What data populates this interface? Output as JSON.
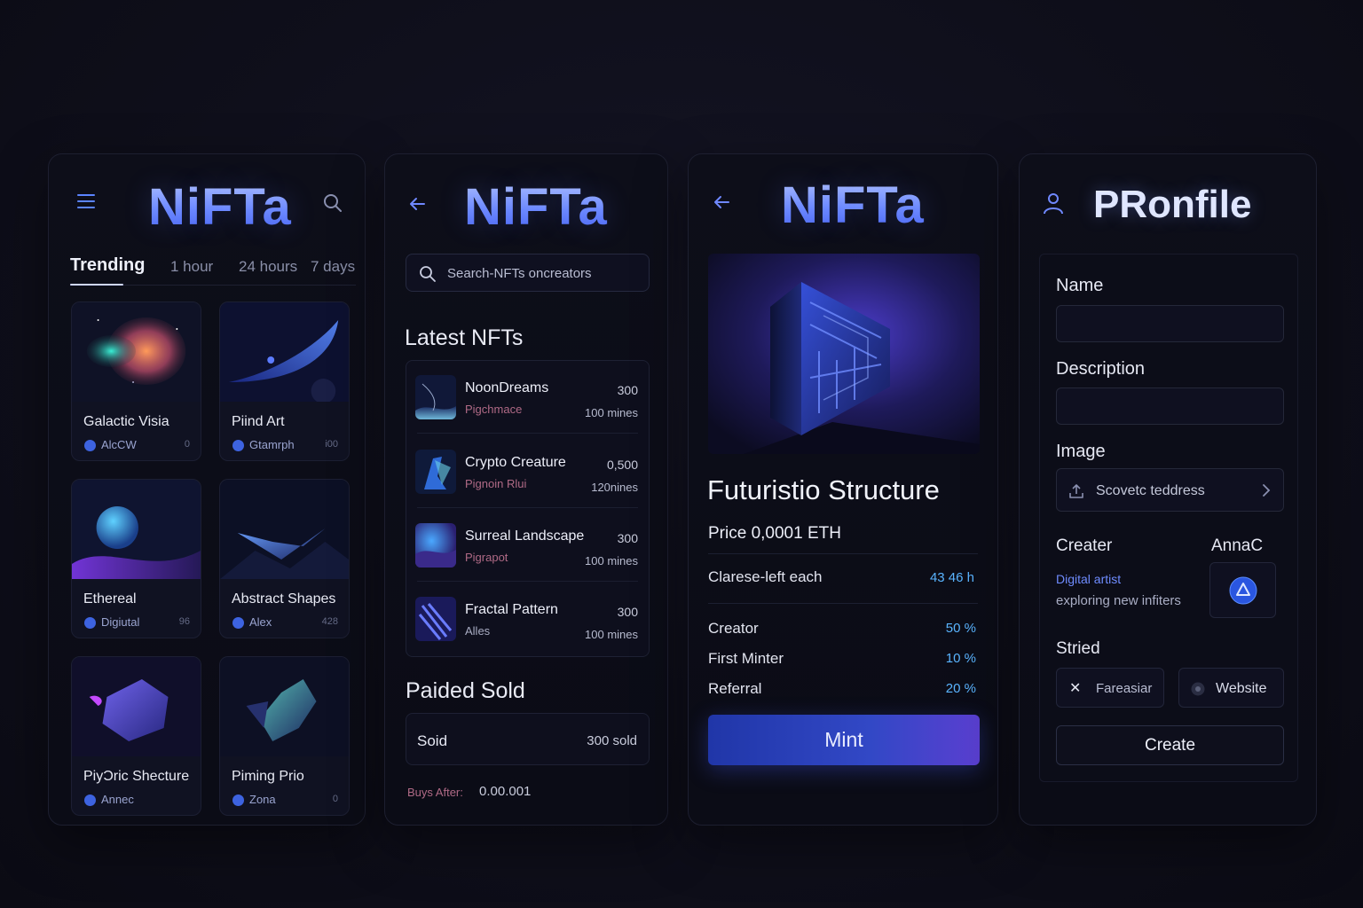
{
  "panel_browse": {
    "logo": "NiFTa",
    "tabs": [
      "Trending",
      "1 hour",
      "24 hours",
      "7 days"
    ],
    "cards": [
      {
        "title": "Galactic Visia",
        "author": "AlcCW",
        "count": "0"
      },
      {
        "title": "Piind Art",
        "author": "Gtamrph",
        "count": "i00"
      },
      {
        "title": "Ethereal",
        "author": "Digiutal",
        "count": "96"
      },
      {
        "title": "Abstract Shapes",
        "author": "Alex",
        "count": "428"
      },
      {
        "title": "PiyƆric Shecture",
        "author": "Annec",
        "count": ""
      },
      {
        "title": "Piming Prio",
        "author": "Zona",
        "count": "0"
      }
    ]
  },
  "panel_latest": {
    "logo": "NiFTa",
    "search_placeholder": "Search-NFTs oncreators",
    "latest_title": "Latest NFTs",
    "items": [
      {
        "name": "NoonDreams",
        "sub": "Pigchmace",
        "price": "300",
        "mines": "100 mines"
      },
      {
        "name": "Crypto Creature",
        "sub": "Pignoin Rlui",
        "price": "0,500",
        "mines": "120nines"
      },
      {
        "name": "Surreal Landscape",
        "sub": "Pigrapot",
        "price": "300",
        "mines": "100 mines"
      },
      {
        "name": "Fractal Pattern",
        "sub": "Alles",
        "price": "300",
        "mines": "100 mines"
      }
    ],
    "sold_title": "Paided Sold",
    "sold_label": "Soid",
    "sold_value": "300 sold",
    "buys_after_label": "Buys After:",
    "buys_after_value": "0.00.001"
  },
  "panel_detail": {
    "logo": "NiFTa",
    "title": "Futuristio Structure",
    "price": "Price 0,0001 ETH",
    "time_label": "Clarese-left each",
    "time_value": "43 46 h",
    "royalties": [
      {
        "label": "Creator",
        "value": "50 %"
      },
      {
        "label": "First Minter",
        "value": "10 %"
      },
      {
        "label": "Referral",
        "value": "20 %"
      }
    ],
    "mint_label": "Mint"
  },
  "panel_profile": {
    "title": "PRonfile",
    "name_label": "Name",
    "description_label": "Description",
    "image_label": "Image",
    "image_select": "Scovetc teddress",
    "creator_label": "Creater",
    "creator_name": "AnnaC",
    "creator_role": "Digital artist",
    "creator_bio": "exploring new infiters",
    "stried_label": "Stried",
    "social_1": "Fareasiar",
    "social_2": "Website",
    "create_label": "Create"
  },
  "colors": {
    "accent": "#4a6cff",
    "cyan_value": "#5ab4ff",
    "background": "#0f0f1b"
  }
}
